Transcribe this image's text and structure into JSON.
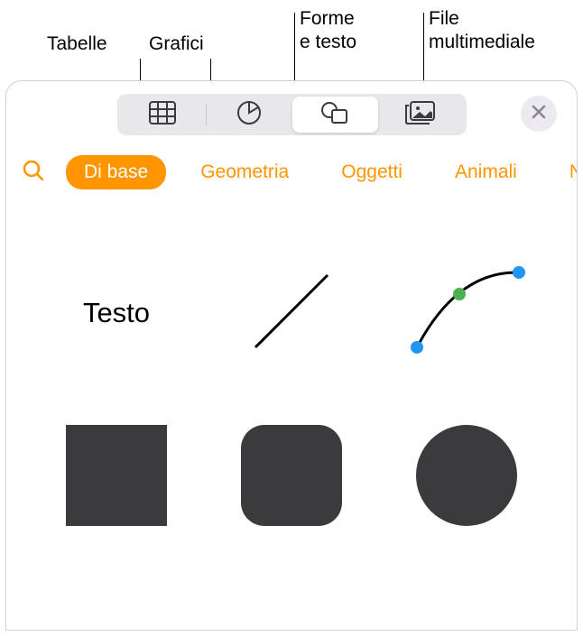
{
  "callouts": {
    "tables": "Tabelle",
    "charts": "Grafici",
    "shapes_text_l1": "Forme",
    "shapes_text_l2": "e testo",
    "media_l1": "File",
    "media_l2": "multimediale"
  },
  "categories": {
    "basic": "Di base",
    "geometry": "Geometria",
    "objects": "Oggetti",
    "animals": "Animali",
    "nature_partial": "N"
  },
  "shapes": {
    "text_label": "Testo"
  }
}
